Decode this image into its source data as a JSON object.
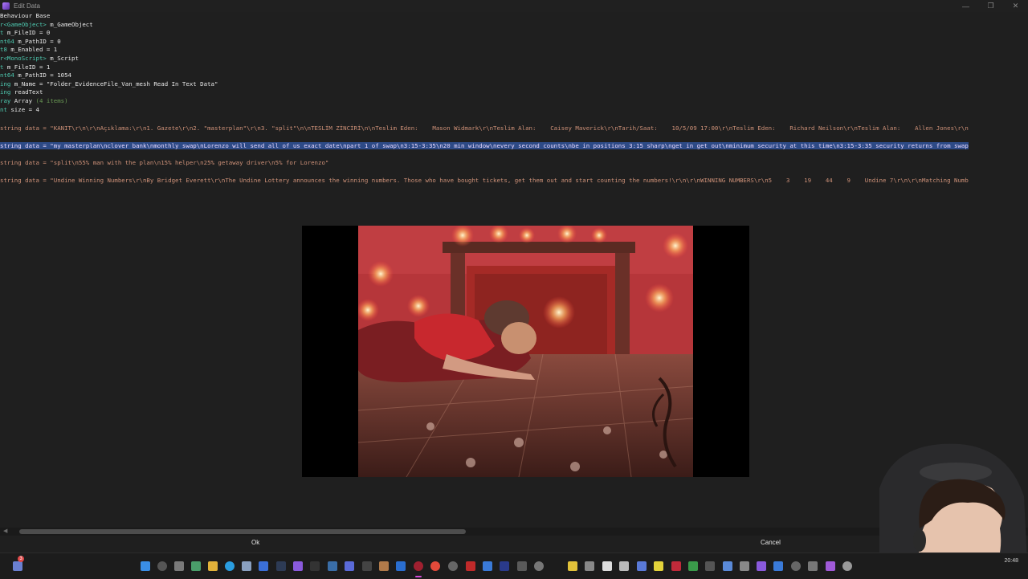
{
  "window": {
    "title": "Edit Data",
    "controls": {
      "minimize": "—",
      "restore": "❐",
      "close": "✕"
    }
  },
  "tree": [
    {
      "type": "",
      "text": "Behaviour Base"
    },
    {
      "type": "r<GameObject>",
      "text": " m_GameObject"
    },
    {
      "type": "t",
      "text": " m_FileID = 0"
    },
    {
      "type": "nt64",
      "text": " m_PathID = 0"
    },
    {
      "type": "t8",
      "text": " m_Enabled = 1"
    },
    {
      "type": "r<MonoScript>",
      "text": " m_Script"
    },
    {
      "type": "t",
      "text": " m_FileID = 1"
    },
    {
      "type": "nt64",
      "text": " m_PathID = 1054"
    },
    {
      "type": "ing",
      "text": " m_Name = \"Folder_EvidenceFile_Van_mesh Read In Text Data\""
    },
    {
      "type": "ing",
      "text": " readText"
    },
    {
      "type": "ray",
      "text": " Array ",
      "extra": "(4 items)"
    },
    {
      "type": "nt",
      "text": " size = 4"
    }
  ],
  "data_lines": [
    "string data = \"KANIT\\r\\n\\r\\nAçıklama:\\r\\n1. Gazete\\r\\n2. \"masterplan\"\\r\\n3. \"split\"\\n\\nTESLİM ZİNCİRİ\\n\\nTeslim Eden:    Mason Widmark\\r\\nTeslim Alan:    Caisey Maverick\\r\\nTarih/Saat:    10/5/09 17:00\\r\\nTeslim Eden:    Richard Neilson\\r\\nTeslim Alan:    Allen Jones\\r\\n",
    "string data = \"my masterplan\\nclover bank\\nmonthly swap\\nLorenzo will send all of us exact date\\npart 1 of swap\\n3:15-3:35\\n20 min window\\nevery second counts\\nbe in positions 3:15 sharp\\nget in get out\\nminimum security at this time\\n3:15-3:35 security returns from swap",
    "string data = \"split\\n55% man with the plan\\n15% helper\\n25% getaway driver\\n5% for Lorenzo\"",
    "string data = \"Undine Winning Numbers\\r\\nBy Bridget Everett\\r\\nThe Undine Lottery announces the winning numbers. Those who have bought tickets, get them out and start counting the numbers!\\r\\n\\r\\nWINNING NUMBERS\\r\\n5    3    19    44    9    Undine 7\\r\\n\\r\\nMatching Numb"
  ],
  "buttons": {
    "ok": "Ok",
    "cancel": "Cancel"
  },
  "taskbar": {
    "notification_count": "3",
    "clock": "20:48"
  },
  "colors": {
    "type_keyword": "#4ec9b0",
    "string_literal": "#ce9178",
    "comment": "#6a9955",
    "selection": "#2d4a86"
  }
}
